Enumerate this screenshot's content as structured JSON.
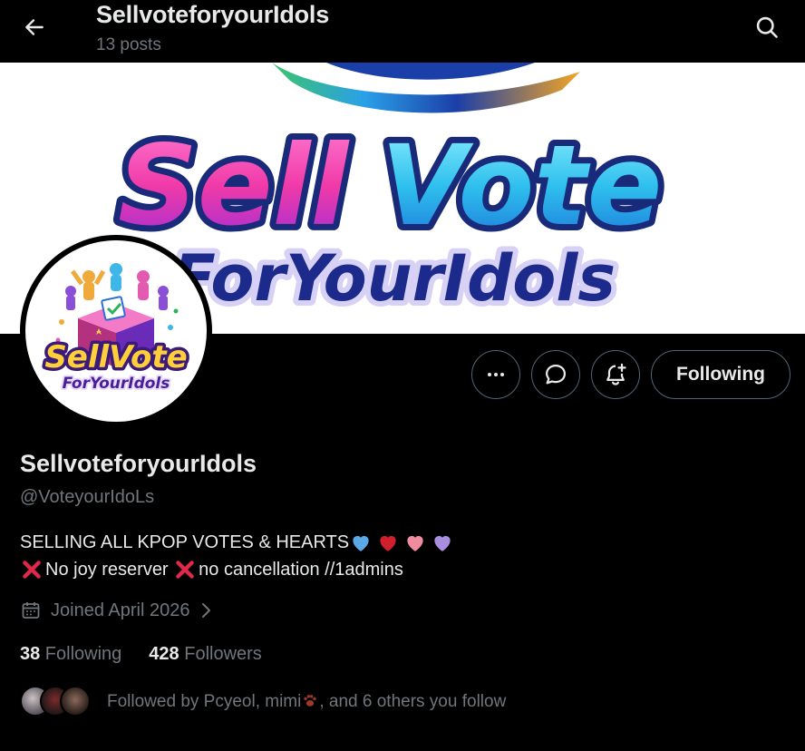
{
  "header": {
    "title": "SellvoteforyourIdols",
    "posts": "13 posts"
  },
  "banner": {
    "line1_a": "Sell",
    "line1_b": "Vote",
    "line2": "ForYourIdols"
  },
  "avatar": {
    "line1": "SellVote",
    "line2": "ForYourIdols"
  },
  "actions": {
    "following_label": "Following"
  },
  "profile": {
    "display_name": "SellvoteforyourIdols",
    "handle": "@VoteyourIdoLs",
    "bio_line1": "SELLING ALL KPOP VOTES & HEARTS",
    "bio_line2_a": "No joy reserver ",
    "bio_line2_b": "no cancellation //1admins",
    "joined": "Joined April 2026",
    "following_count": "38",
    "following_label": " Following",
    "followers_count": "428",
    "followers_label": " Followers",
    "followed_by_a": "Followed by Pcyeol, mimi",
    "followed_by_b": ", and 6 others you follow"
  },
  "colors": {
    "background": "#000000",
    "text": "#e7e9ea",
    "muted": "#71767b",
    "border": "#536471",
    "heart_blue": "#5ba8e6",
    "heart_red": "#d0202e",
    "heart_pink": "#f08ca0",
    "heart_purple": "#a98ee0",
    "x_red": "#e0294a"
  }
}
